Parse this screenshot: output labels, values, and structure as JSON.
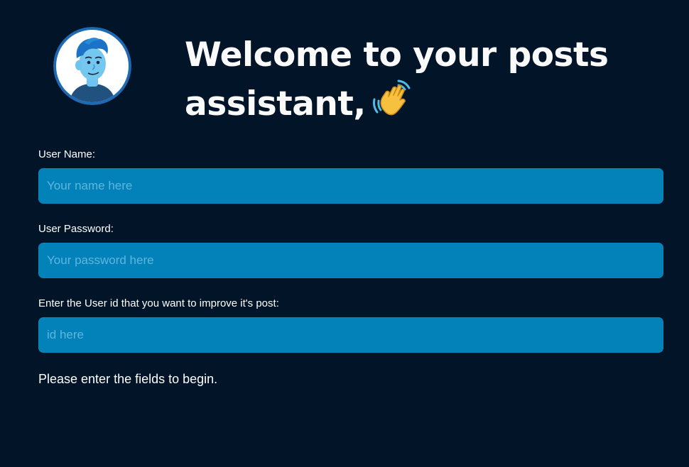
{
  "header": {
    "avatar_icon": "cartoon-man-avatar",
    "title": "Welcome to your posts assistant,",
    "emoji_icon": "waving-hand-emoji"
  },
  "form": {
    "username": {
      "label": "User Name:",
      "placeholder": "Your name here",
      "value": ""
    },
    "password": {
      "label": "User Password:",
      "placeholder": "Your password here",
      "value": ""
    },
    "user_id": {
      "label": "Enter the User id that you want to improve it's post:",
      "placeholder": "id here",
      "value": ""
    }
  },
  "status": {
    "message": "Please enter the fields to begin."
  },
  "colors": {
    "background": "#011428",
    "input_background": "#0282b8",
    "placeholder": "#5fb6dd",
    "text": "#ffffff"
  }
}
